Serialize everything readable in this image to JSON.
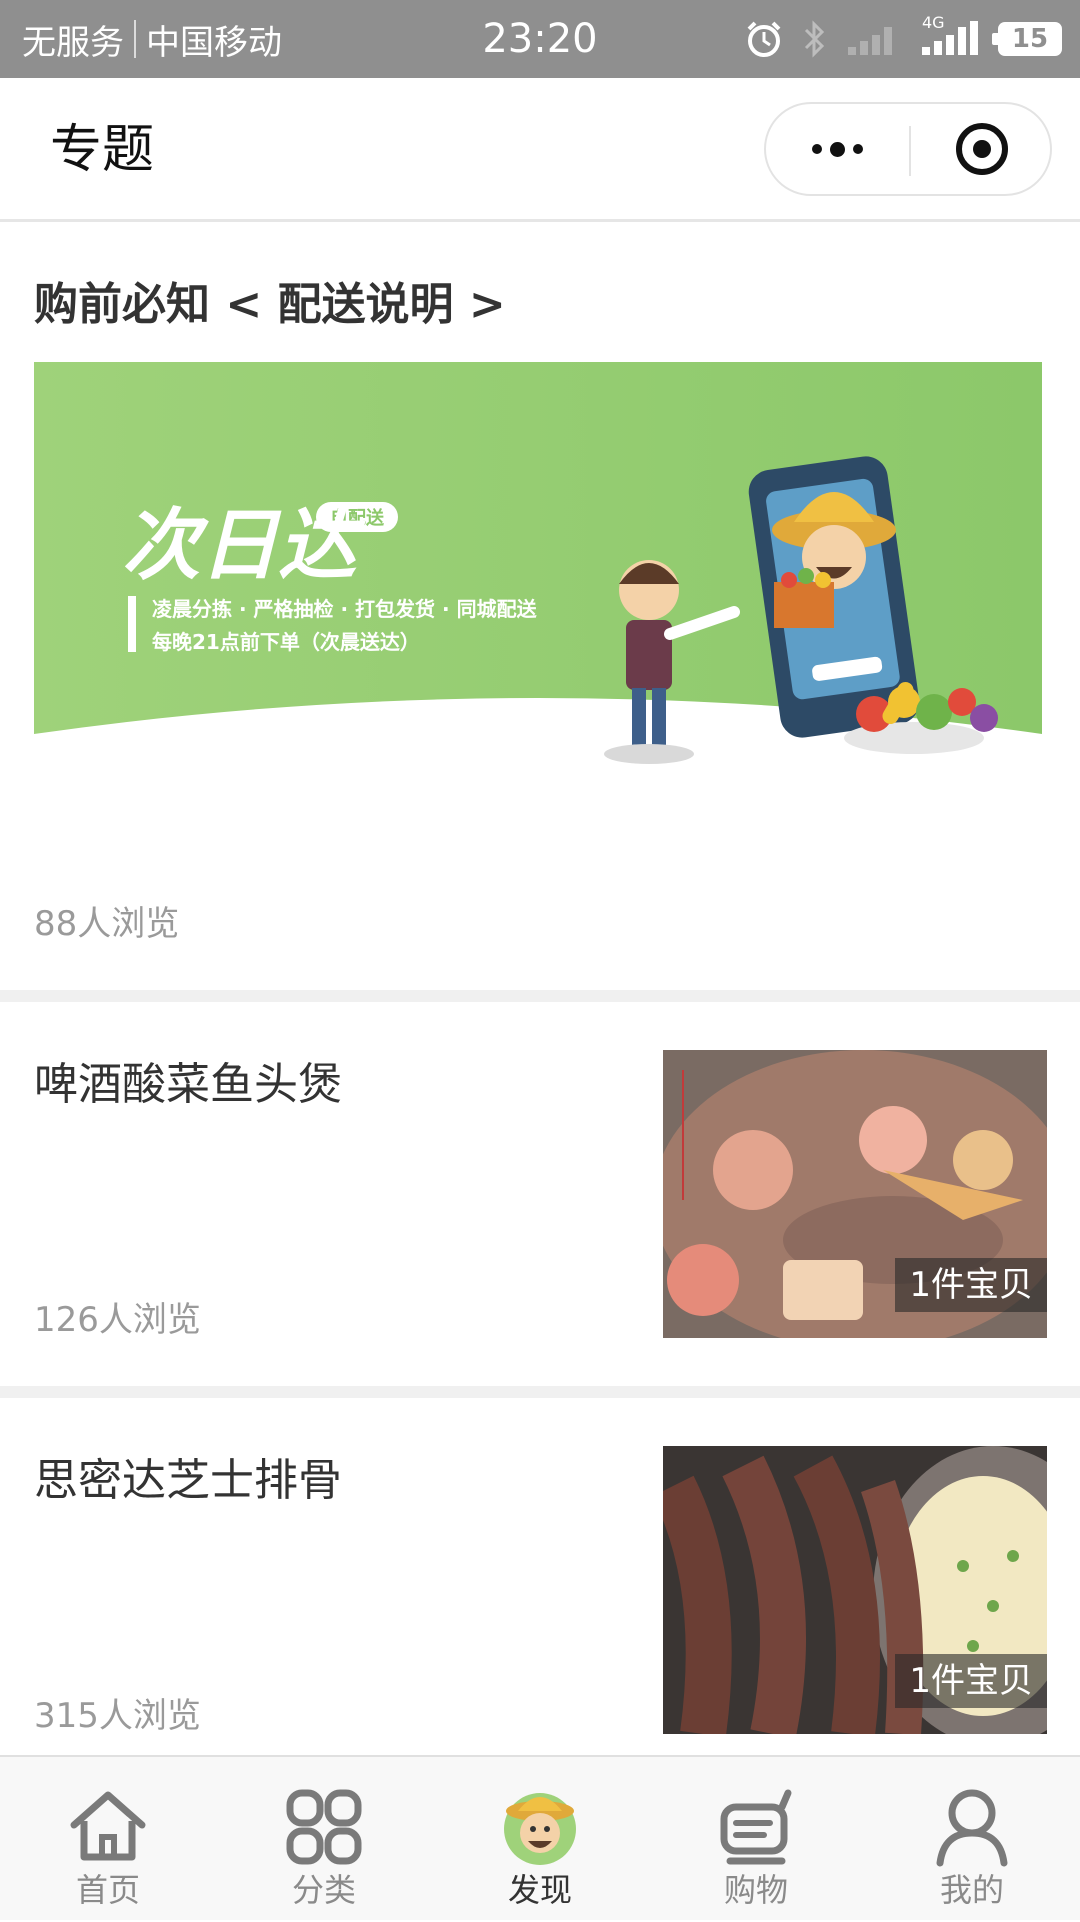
{
  "status_bar": {
    "no_service": "无服务",
    "carrier": "中国移动",
    "time": "23:20",
    "network": "4G",
    "battery": "15"
  },
  "header": {
    "title": "专题"
  },
  "featured": {
    "title": "购前必知 < 配送说明 >",
    "banner": {
      "brand": "次日达",
      "tag": "自配送",
      "line1": "凌晨分拣 · 严格抽检 · 打包发货 · 同城配送",
      "line2": "每晚21点前下单（次晨送达）"
    },
    "views": "88人浏览"
  },
  "items": [
    {
      "title": "啤酒酸菜鱼头煲",
      "views": "126人浏览",
      "badge": "1件宝贝"
    },
    {
      "title": "思密达芝士排骨",
      "views": "315人浏览",
      "badge": "1件宝贝"
    }
  ],
  "tabbar": {
    "tabs": [
      {
        "label": "首页",
        "icon": "home-icon"
      },
      {
        "label": "分类",
        "icon": "category-grid-icon"
      },
      {
        "label": "发现",
        "icon": "discover-farmer-icon",
        "active": true
      },
      {
        "label": "购物",
        "icon": "cart-icon"
      },
      {
        "label": "我的",
        "icon": "user-icon"
      }
    ]
  },
  "colors": {
    "status_bar_bg": "#8f8f8f",
    "banner_green": "#a6d77b",
    "section_gap": "#f0f0f0",
    "muted_text": "#9a9a9a"
  }
}
